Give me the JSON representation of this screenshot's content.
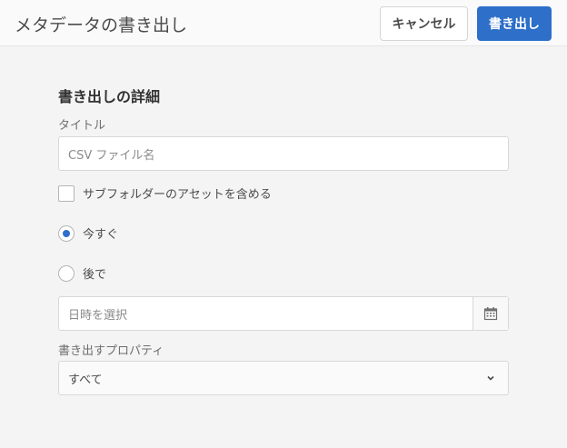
{
  "header": {
    "title": "メタデータの書き出し",
    "cancel_label": "キャンセル",
    "export_label": "書き出し"
  },
  "form": {
    "section_title": "書き出しの詳細",
    "title_label": "タイトル",
    "title_placeholder": "CSV ファイル名",
    "subfolder_label": "サブフォルダーのアセットを含める",
    "subfolder_checked": false,
    "now_label": "今すぐ",
    "later_label": "後で",
    "schedule_selected": "now",
    "datetime_placeholder": "日時を選択",
    "properties_label": "書き出すプロパティ",
    "properties_value": "すべて"
  }
}
